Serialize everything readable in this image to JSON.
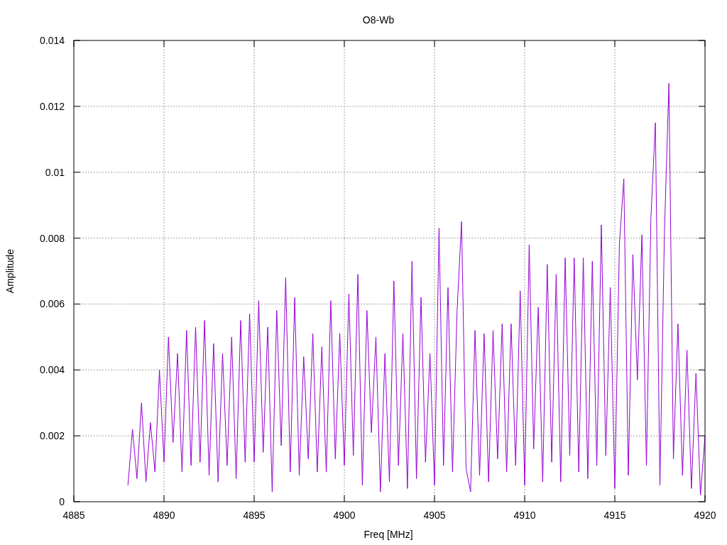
{
  "chart_data": {
    "type": "line",
    "grid": true,
    "title": "O8-Wb",
    "xlabel": "Freq [MHz]",
    "ylabel": "Amplitude",
    "xlim": [
      4885,
      4920
    ],
    "ylim": [
      0,
      0.014
    ],
    "xticks": [
      4885,
      4890,
      4895,
      4900,
      4905,
      4910,
      4915,
      4920
    ],
    "yticks": [
      {
        "value": 0,
        "label": "0"
      },
      {
        "value": 0.002,
        "label": "0.002"
      },
      {
        "value": 0.004,
        "label": "0.004"
      },
      {
        "value": 0.006,
        "label": "0.006"
      },
      {
        "value": 0.008,
        "label": "0.008"
      },
      {
        "value": 0.01,
        "label": "0.01"
      },
      {
        "value": 0.012,
        "label": "0.012"
      },
      {
        "value": 0.014,
        "label": "0.014"
      }
    ],
    "x": [
      4888,
      4888.25,
      4888.5,
      4888.75,
      4889,
      4889.25,
      4889.5,
      4889.75,
      4890,
      4890.25,
      4890.5,
      4890.75,
      4891,
      4891.25,
      4891.5,
      4891.75,
      4892,
      4892.25,
      4892.5,
      4892.75,
      4893,
      4893.25,
      4893.5,
      4893.75,
      4894,
      4894.25,
      4894.5,
      4894.75,
      4895,
      4895.25,
      4895.5,
      4895.75,
      4896,
      4896.25,
      4896.5,
      4896.75,
      4897,
      4897.25,
      4897.5,
      4897.75,
      4898,
      4898.25,
      4898.5,
      4898.75,
      4899,
      4899.25,
      4899.5,
      4899.75,
      4900,
      4900.25,
      4900.5,
      4900.75,
      4901,
      4901.25,
      4901.5,
      4901.75,
      4902,
      4902.25,
      4902.5,
      4902.75,
      4903,
      4903.25,
      4903.5,
      4903.75,
      4904,
      4904.25,
      4904.5,
      4904.75,
      4905,
      4905.25,
      4905.5,
      4905.75,
      4906,
      4906.25,
      4906.5,
      4906.75,
      4907,
      4907.25,
      4907.5,
      4907.75,
      4908,
      4908.25,
      4908.5,
      4908.75,
      4909,
      4909.25,
      4909.5,
      4909.75,
      4910,
      4910.25,
      4910.5,
      4910.75,
      4911,
      4911.25,
      4911.5,
      4911.75,
      4912,
      4912.25,
      4912.5,
      4912.75,
      4913,
      4913.25,
      4913.5,
      4913.75,
      4914,
      4914.25,
      4914.5,
      4914.75,
      4915,
      4915.25,
      4915.5,
      4915.75,
      4916,
      4916.25,
      4916.5,
      4916.75,
      4917,
      4917.25,
      4917.5,
      4917.75,
      4918,
      4918.25,
      4918.5,
      4918.75,
      4919,
      4919.25,
      4919.5,
      4919.75,
      4920
    ],
    "series": [
      {
        "color": "#9400d3",
        "values": [
          0.0005,
          0.0022,
          0.0007,
          0.003,
          0.0006,
          0.0024,
          0.0009,
          0.004,
          0.0012,
          0.005,
          0.0018,
          0.0045,
          0.0009,
          0.0052,
          0.0011,
          0.0053,
          0.0012,
          0.0055,
          0.0008,
          0.0048,
          0.0006,
          0.0045,
          0.0011,
          0.005,
          0.0007,
          0.0055,
          0.0012,
          0.0057,
          0.0012,
          0.0061,
          0.0015,
          0.0053,
          0.0003,
          0.0058,
          0.0017,
          0.0068,
          0.0009,
          0.0062,
          0.0008,
          0.0044,
          0.0013,
          0.0051,
          0.0009,
          0.0047,
          0.0009,
          0.0061,
          0.0013,
          0.0051,
          0.0011,
          0.0063,
          0.0014,
          0.0069,
          0.0005,
          0.0058,
          0.0021,
          0.005,
          0.0003,
          0.0045,
          0.0006,
          0.0067,
          0.0011,
          0.0051,
          0.0004,
          0.0073,
          0.0007,
          0.0062,
          0.0012,
          0.0045,
          0.0005,
          0.0083,
          0.0011,
          0.0065,
          0.0009,
          0.0058,
          0.0085,
          0.001,
          0.0003,
          0.0052,
          0.0008,
          0.0051,
          0.0006,
          0.0052,
          0.0013,
          0.0054,
          0.0009,
          0.0054,
          0.0011,
          0.0064,
          0.0005,
          0.0078,
          0.0016,
          0.0059,
          0.0006,
          0.0072,
          0.0012,
          0.0069,
          0.0006,
          0.0074,
          0.0014,
          0.0074,
          0.0009,
          0.0074,
          0.0007,
          0.0073,
          0.0011,
          0.0084,
          0.0014,
          0.0065,
          0.0004,
          0.0078,
          0.0098,
          0.0008,
          0.0075,
          0.0037,
          0.0081,
          0.0011,
          0.0086,
          0.0115,
          0.0005,
          0.0082,
          0.0127,
          0.0013,
          0.0054,
          0.0008,
          0.0046,
          0.0004,
          0.0039,
          0.0002,
          0.002
        ]
      }
    ]
  }
}
